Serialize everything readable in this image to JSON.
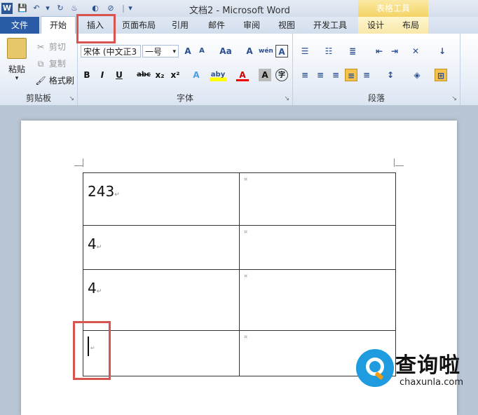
{
  "titlebar": {
    "quick_access": [
      "W",
      "💾",
      "↶",
      "▾",
      "↻",
      "♨",
      "◐",
      "⊘",
      "|",
      "▾"
    ],
    "title": "文档2 - Microsoft Word",
    "context_group": "表格工具"
  },
  "tabs": [
    {
      "label": "文件"
    },
    {
      "label": "开始"
    },
    {
      "label": "插入"
    },
    {
      "label": "页面布局"
    },
    {
      "label": "引用"
    },
    {
      "label": "邮件"
    },
    {
      "label": "审阅"
    },
    {
      "label": "视图"
    },
    {
      "label": "开发工具"
    },
    {
      "label": "设计"
    },
    {
      "label": "布局"
    }
  ],
  "ribbon": {
    "clipboard": {
      "paste_label": "粘贴",
      "cut_label": "剪切",
      "copy_label": "复制",
      "format_painter_label": "格式刷",
      "group_label": "剪贴板"
    },
    "font": {
      "font_name": "宋体 (中文正3",
      "font_size": "一号",
      "grow": "A",
      "shrink": "A",
      "case": "Aa",
      "clear": "A",
      "phonetic": "wén",
      "border_char": "A",
      "bold": "B",
      "italic": "I",
      "underline": "U",
      "strike": "abc",
      "sub": "x₂",
      "sup": "x²",
      "effect": "A",
      "highlight": "aby",
      "color": "A",
      "shade": "A",
      "enclose": "字",
      "group_label": "字体"
    },
    "paragraph": {
      "group_label": "段落"
    }
  },
  "table": {
    "rows": [
      {
        "c1": "243",
        "c2": ""
      },
      {
        "c1": "4",
        "c2": ""
      },
      {
        "c1": "4",
        "c2": ""
      },
      {
        "c1": "",
        "c2": ""
      }
    ]
  },
  "watermark": {
    "title": "查询啦",
    "url": "chaxunla.com"
  },
  "colors": {
    "file_tab": "#2a5ca8",
    "highlight_box": "#d9534f",
    "context_tab": "#f4d465"
  }
}
